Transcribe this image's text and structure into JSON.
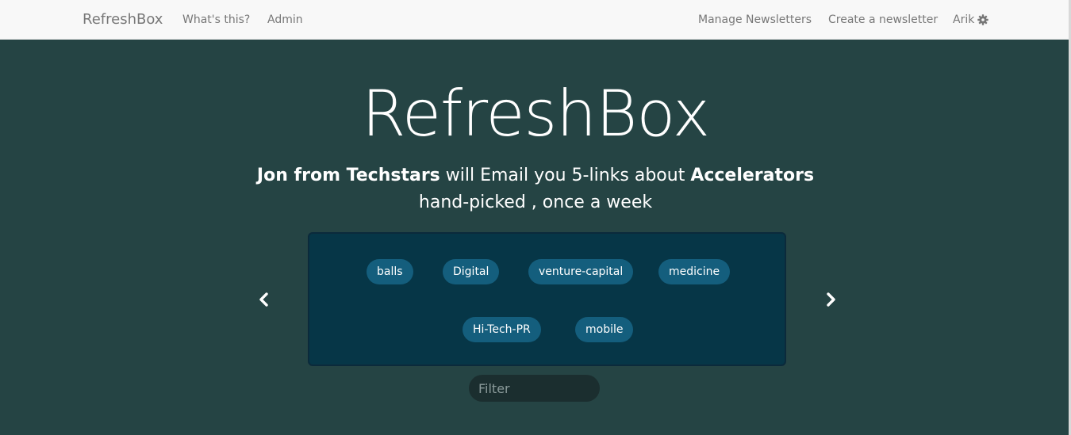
{
  "navbar": {
    "brand": "RefreshBox",
    "links": [
      "What's this?",
      "Admin"
    ],
    "right_links": [
      "Manage Newsletters",
      "Create a newsletter"
    ],
    "user": "Arik",
    "user_icon": "gear-icon"
  },
  "hero": {
    "title": "RefreshBox",
    "tagline_name": "Jon from Techstars",
    "tagline_mid": " will Email you 5-links about ",
    "tagline_topic": "Accelerators",
    "tagline_line2": "hand-picked , once a week"
  },
  "carousel": {
    "tags": [
      "balls",
      "Digital",
      "venture-capital",
      "medicine",
      "Hi-Tech-PR",
      "mobile"
    ],
    "prev_icon": "chevron-left-icon",
    "next_icon": "chevron-right-icon"
  },
  "filter": {
    "placeholder": "Filter",
    "value": ""
  },
  "colors": {
    "hero_bg": "#254444",
    "carousel_bg": "#063647",
    "tag_bg": "#145e7d",
    "navbar_bg": "#f8f8f8",
    "nav_text": "#777777"
  }
}
